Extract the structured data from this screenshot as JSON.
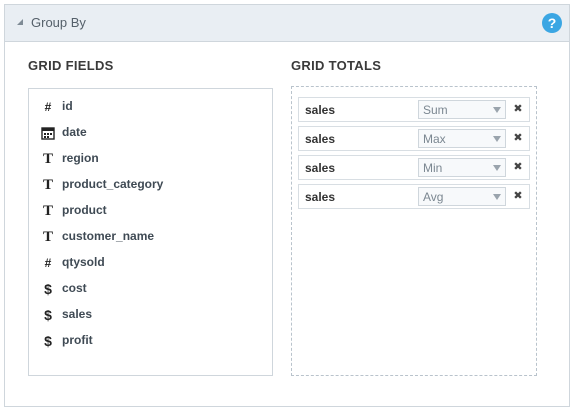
{
  "panel": {
    "title": "Group By",
    "help_icon": "help-icon",
    "help_glyph": "?"
  },
  "grid_fields": {
    "title": "GRID FIELDS",
    "items": [
      {
        "label": "id",
        "type": "number",
        "glyph": "#"
      },
      {
        "label": "date",
        "type": "date",
        "glyph": ""
      },
      {
        "label": "region",
        "type": "text",
        "glyph": "T"
      },
      {
        "label": "product_category",
        "type": "text",
        "glyph": "T"
      },
      {
        "label": "product",
        "type": "text",
        "glyph": "T"
      },
      {
        "label": "customer_name",
        "type": "text",
        "glyph": "T"
      },
      {
        "label": "qtysold",
        "type": "number",
        "glyph": "#"
      },
      {
        "label": "cost",
        "type": "currency",
        "glyph": "$"
      },
      {
        "label": "sales",
        "type": "currency",
        "glyph": "$"
      },
      {
        "label": "profit",
        "type": "currency",
        "glyph": "$"
      }
    ]
  },
  "grid_totals": {
    "title": "GRID TOTALS",
    "rows": [
      {
        "field": "sales",
        "aggregate": "Sum",
        "remove_glyph": "✖"
      },
      {
        "field": "sales",
        "aggregate": "Max",
        "remove_glyph": "✖"
      },
      {
        "field": "sales",
        "aggregate": "Min",
        "remove_glyph": "✖"
      },
      {
        "field": "sales",
        "aggregate": "Avg",
        "remove_glyph": "✖"
      }
    ]
  },
  "colors": {
    "header_bg": "#e9eef3",
    "help_icon": "#3ba6e3",
    "border": "#cfd6dc"
  }
}
